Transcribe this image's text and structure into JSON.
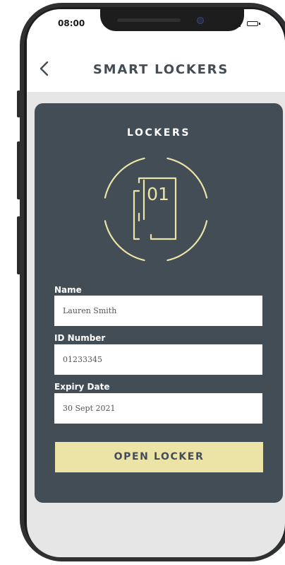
{
  "status_bar": {
    "time": "08:00"
  },
  "header": {
    "title": "SMART LOCKERS",
    "back_icon": "chevron-left-icon"
  },
  "card": {
    "title": "LOCKERS",
    "emblem_text": "01",
    "fields": [
      {
        "label": "Name",
        "value": "Lauren Smith"
      },
      {
        "label": "ID Number",
        "value": "01233345"
      },
      {
        "label": "Expiry Date",
        "value": "30 Sept 2021"
      }
    ],
    "open_button_label": "OPEN LOCKER"
  },
  "colors": {
    "card": "#424d56",
    "accent": "#ece3a6",
    "screen_bg": "#e6e6e6",
    "title_text": "#424d56"
  }
}
